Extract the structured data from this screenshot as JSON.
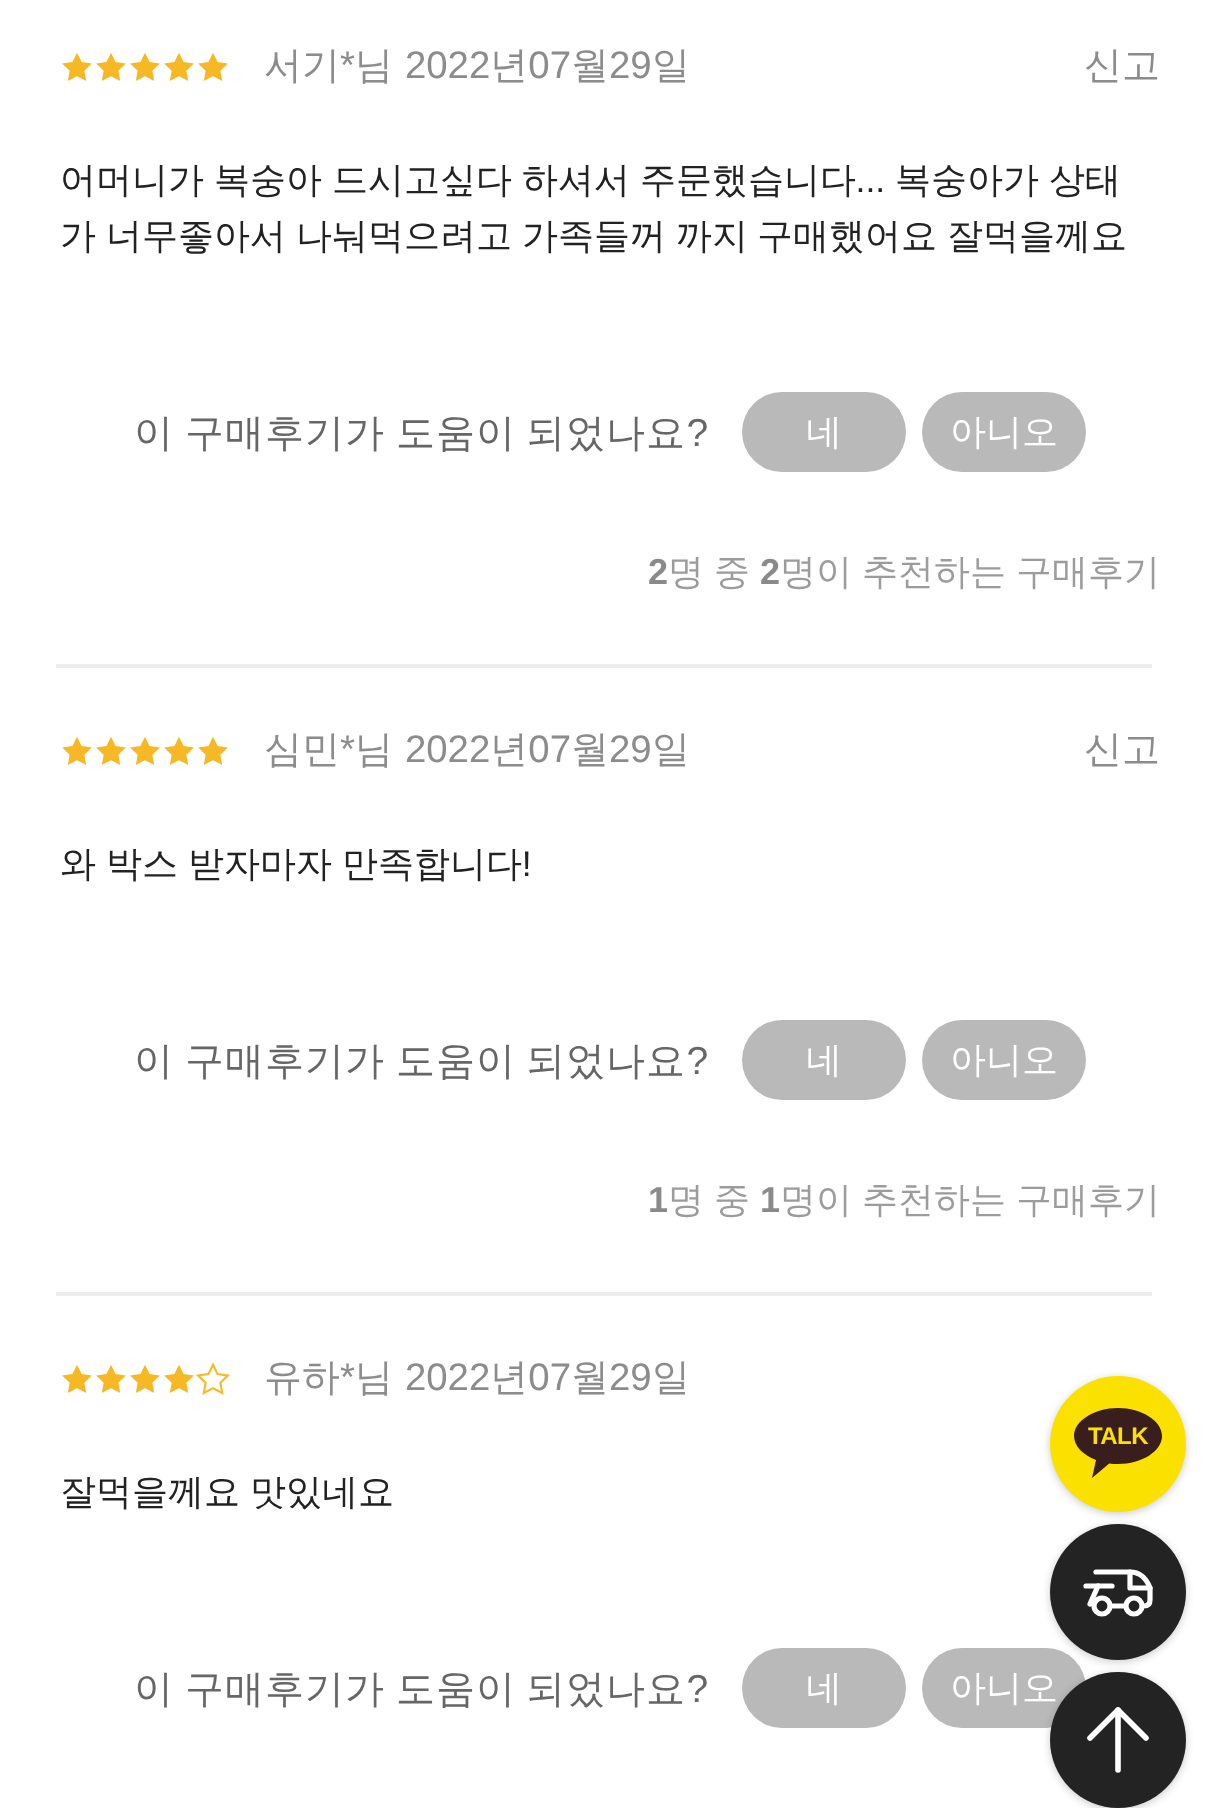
{
  "reviews": [
    {
      "stars": 5,
      "author": "서기*님",
      "date": "2022년07월29일",
      "report": "신고",
      "text": "어머니가 복숭아 드시고싶다 하셔서 주문했습니다... 복숭아가 상태가 너무좋아서 나눠먹으려고 가족들꺼 까지 구매했어요 잘먹을께요",
      "helpful_question": "이 구매후기가 도움이 되었나요?",
      "buttons": [
        "네",
        "아니오"
      ],
      "recommend": "**2**명 중 **2**명이 추천하는 구매후기"
    },
    {
      "stars": 5,
      "author": "심민*님",
      "date": "2022년07월29일",
      "report": "신고",
      "text": "와 박스 받자마자 만족합니다!",
      "helpful_question": "이 구매후기가 도움이 되었나요?",
      "buttons": [
        "네",
        "아니오"
      ],
      "recommend": "**1**명 중 **1**명이 추천하는 구매후기"
    },
    {
      "stars": 4,
      "author": "유하*님",
      "date": "2022년07월29일",
      "text": "잘먹을께요 맛있네요",
      "helpful_question": "이 구매후기가 도움이 되었나요?",
      "buttons": [
        "네",
        "아니오"
      ]
    }
  ],
  "floating_buttons": [
    {
      "kind": "chat",
      "label": "TALK"
    },
    {
      "kind": "delivery"
    },
    {
      "kind": "top"
    }
  ]
}
